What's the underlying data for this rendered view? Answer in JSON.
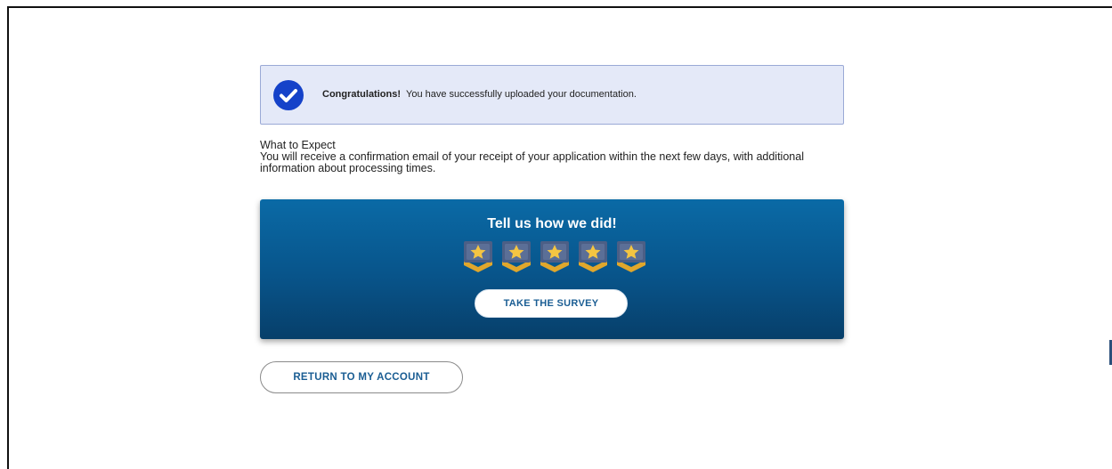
{
  "alert": {
    "strong": "Congratulations!",
    "message": "You have successfully uploaded your documentation.",
    "icon": "check-circle-icon"
  },
  "expect": {
    "heading": "What to Expect",
    "body": "You will receive a confirmation email of your receipt of your application within the next few days, with additional information about processing times."
  },
  "survey": {
    "title": "Tell us how we did!",
    "rating_icons": [
      "star-badge-icon",
      "star-badge-icon",
      "star-badge-icon",
      "star-badge-icon",
      "star-badge-icon"
    ],
    "button_label": "TAKE THE SURVEY"
  },
  "return_button": "RETURN TO MY ACCOUNT",
  "colors": {
    "alert_bg": "#e4e9f8",
    "check": "#1542c9",
    "card_top": "#0a6aa6",
    "card_bottom": "#073f6a",
    "link_text": "#1a5d93",
    "star_gold": "#f4c542"
  }
}
